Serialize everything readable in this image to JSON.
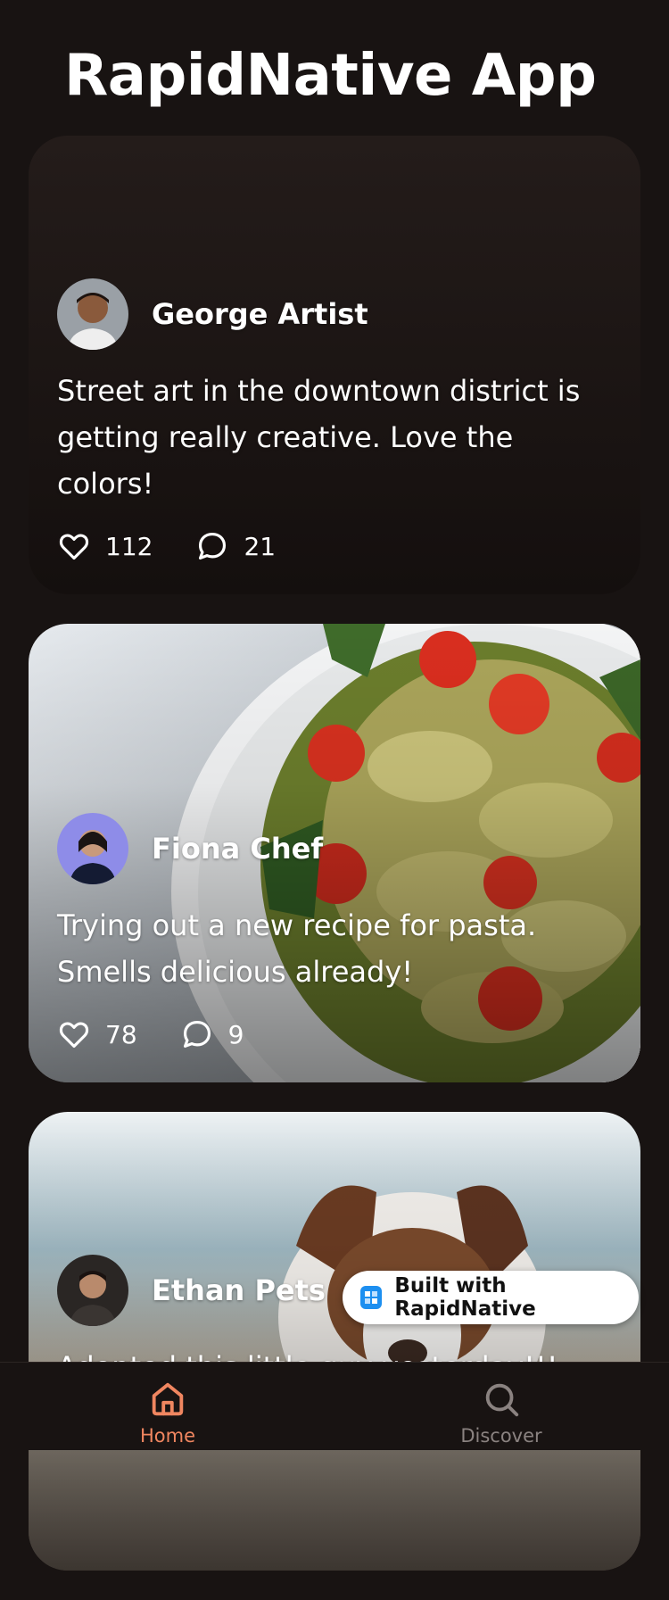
{
  "app": {
    "title": "RapidNative App"
  },
  "posts": [
    {
      "author": "George Artist",
      "text": "Street art in the downtown district is getting really creative. Love the colors!",
      "likes": "112",
      "comments": "21"
    },
    {
      "author": "Fiona Chef",
      "text": "Trying out a new recipe for pasta. Smells delicious already!",
      "likes": "78",
      "comments": "9"
    },
    {
      "author": "Ethan Pets",
      "text": "Adopted this little guy yesterday!!!",
      "likes": "",
      "comments": ""
    }
  ],
  "badge": {
    "label": "Built with RapidNative"
  },
  "tabs": [
    {
      "label": "Home",
      "icon": "home-icon",
      "active": true
    },
    {
      "label": "Discover",
      "icon": "search-icon",
      "active": false
    }
  ],
  "colors": {
    "background": "#181312",
    "accent": "#f08660",
    "inactive_tab": "#8a8280"
  }
}
